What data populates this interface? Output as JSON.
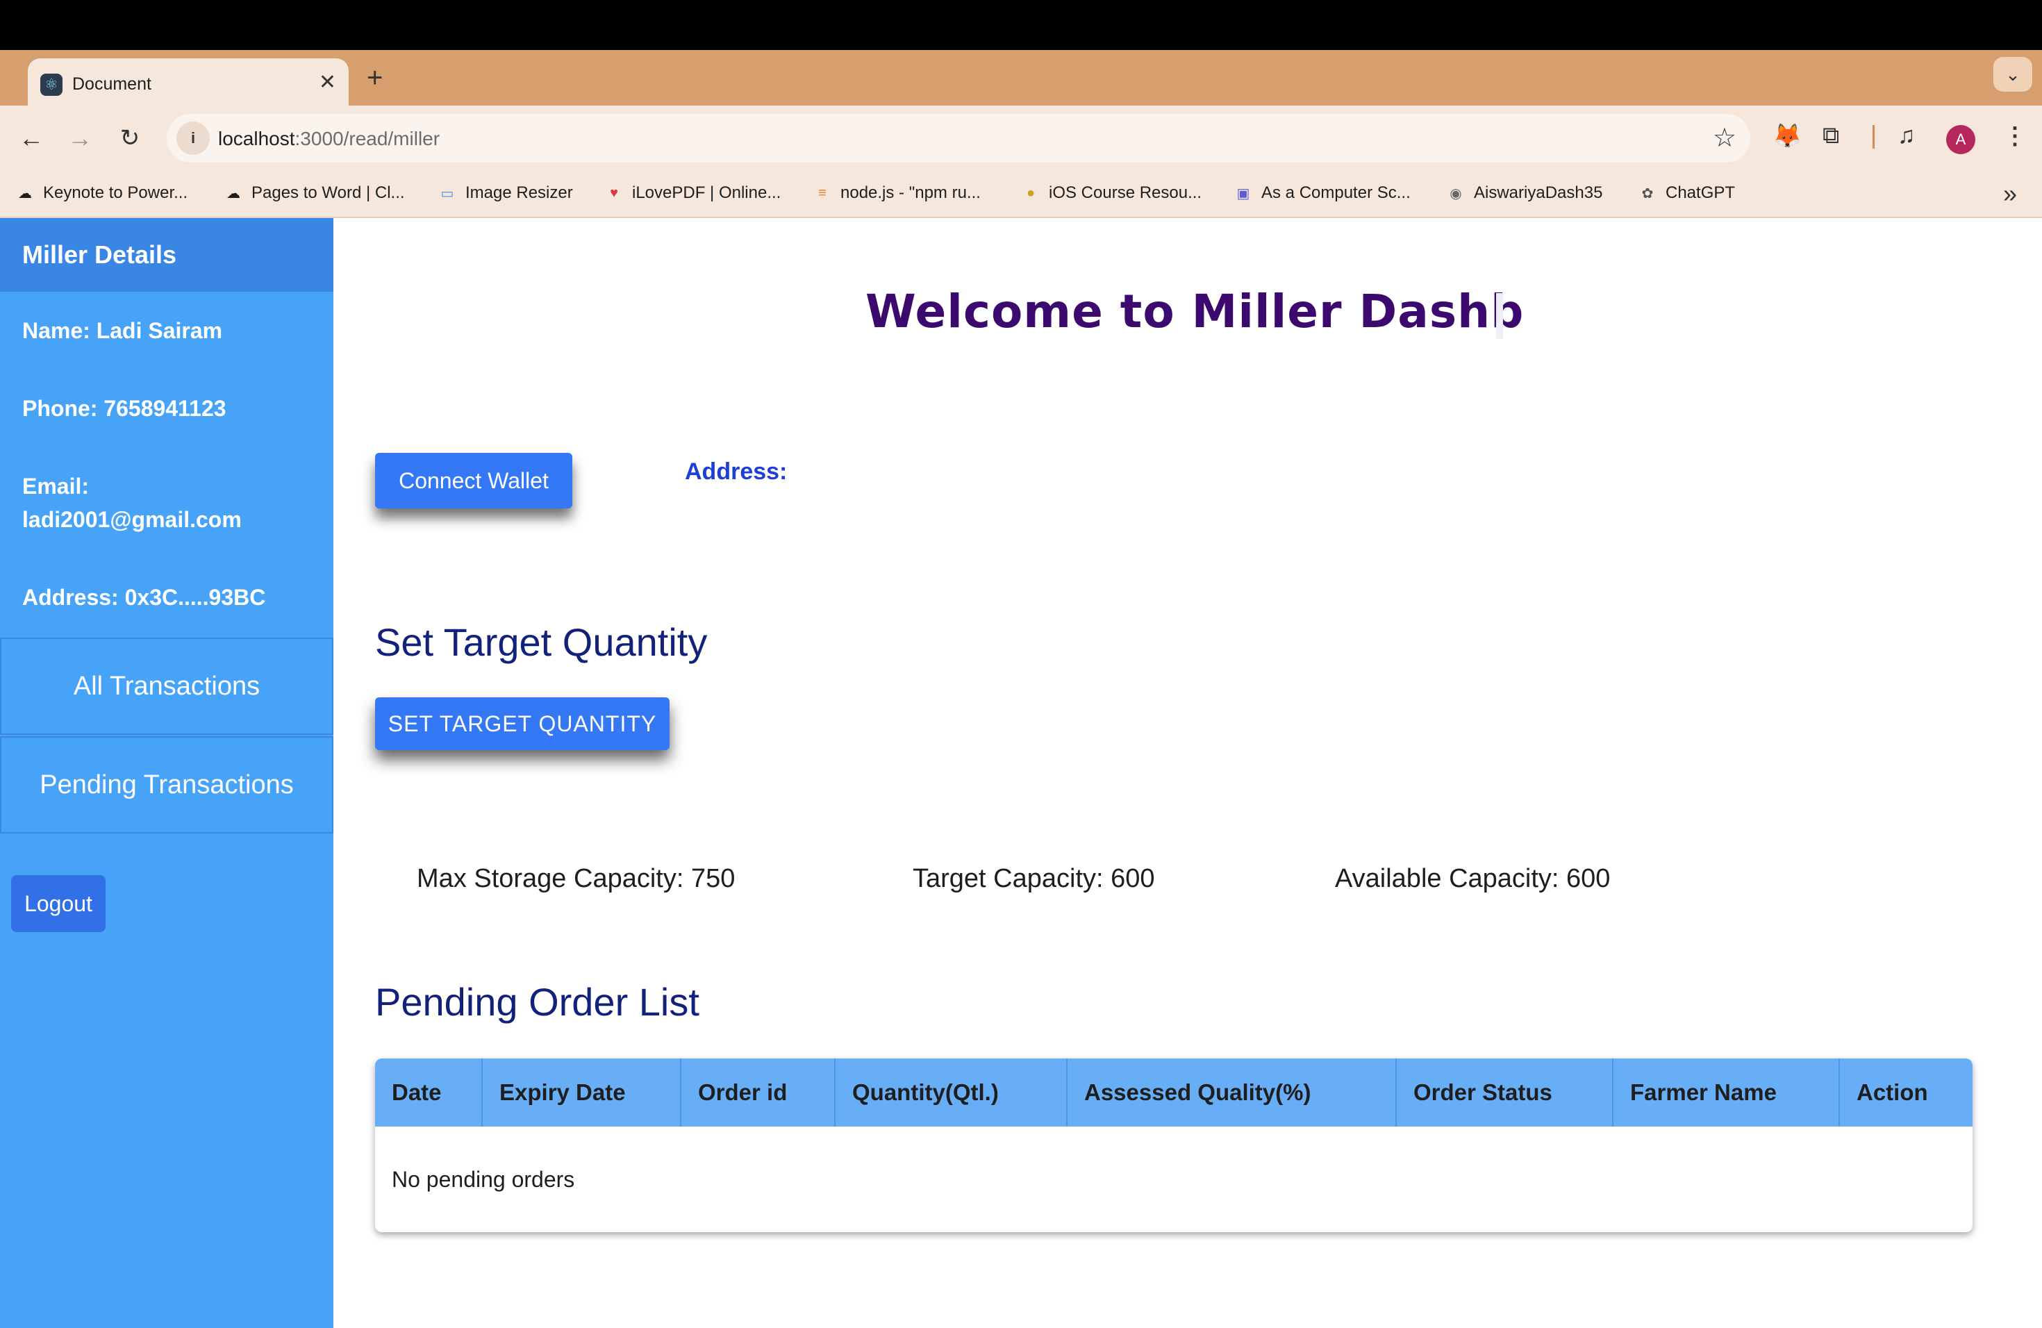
{
  "browser": {
    "tab_title": "Document",
    "url_host": "localhost",
    "url_path": ":3000/read/miller",
    "avatar_letter": "A",
    "bookmarks": [
      {
        "label": "Keynote to Power...",
        "icon": "cloud-icon"
      },
      {
        "label": "Pages to Word | Cl...",
        "icon": "cloud-icon"
      },
      {
        "label": "Image Resizer",
        "icon": "image-icon"
      },
      {
        "label": "iLovePDF | Online...",
        "icon": "heart-icon"
      },
      {
        "label": "node.js - \"npm ru...",
        "icon": "stack-overflow-icon"
      },
      {
        "label": "iOS Course Resou...",
        "icon": "course-icon"
      },
      {
        "label": "As a Computer Sc...",
        "icon": "printer-icon"
      },
      {
        "label": "AiswariyaDash35",
        "icon": "github-icon"
      },
      {
        "label": "ChatGPT",
        "icon": "chatgpt-icon"
      }
    ]
  },
  "sidebar": {
    "title": "Miller Details",
    "name": "Name: Ladi Sairam",
    "phone": "Phone: 7658941123",
    "email": "Email: ladi2001@gmail.com",
    "address": "Address: 0x3C.....93BC",
    "nav": [
      "All Transactions",
      "Pending Transactions"
    ],
    "logout": "Logout"
  },
  "main": {
    "welcome": "Welcome to Miller Dashb",
    "connect_wallet": "Connect Wallet",
    "address_label": "Address:",
    "set_target_heading": "Set Target Quantity",
    "set_target_button": "SET TARGET QUANTITY",
    "capacities": {
      "max": "Max Storage Capacity: 750",
      "target": "Target Capacity: 600",
      "available": "Available Capacity: 600"
    },
    "pending_heading": "Pending Order List",
    "table": {
      "columns": [
        "Date",
        "Expiry Date",
        "Order id",
        "Quantity(Qtl.)",
        "Assessed Quality(%)",
        "Order Status",
        "Farmer Name",
        "Action"
      ],
      "empty_message": "No pending orders"
    }
  },
  "colors": {
    "sidebar": "#47a3f8",
    "sidebar_header": "#3a86e4",
    "button": "#3478f6",
    "heading": "#12227a",
    "welcome": "#3c0a6e",
    "table_header": "#67aef7"
  }
}
